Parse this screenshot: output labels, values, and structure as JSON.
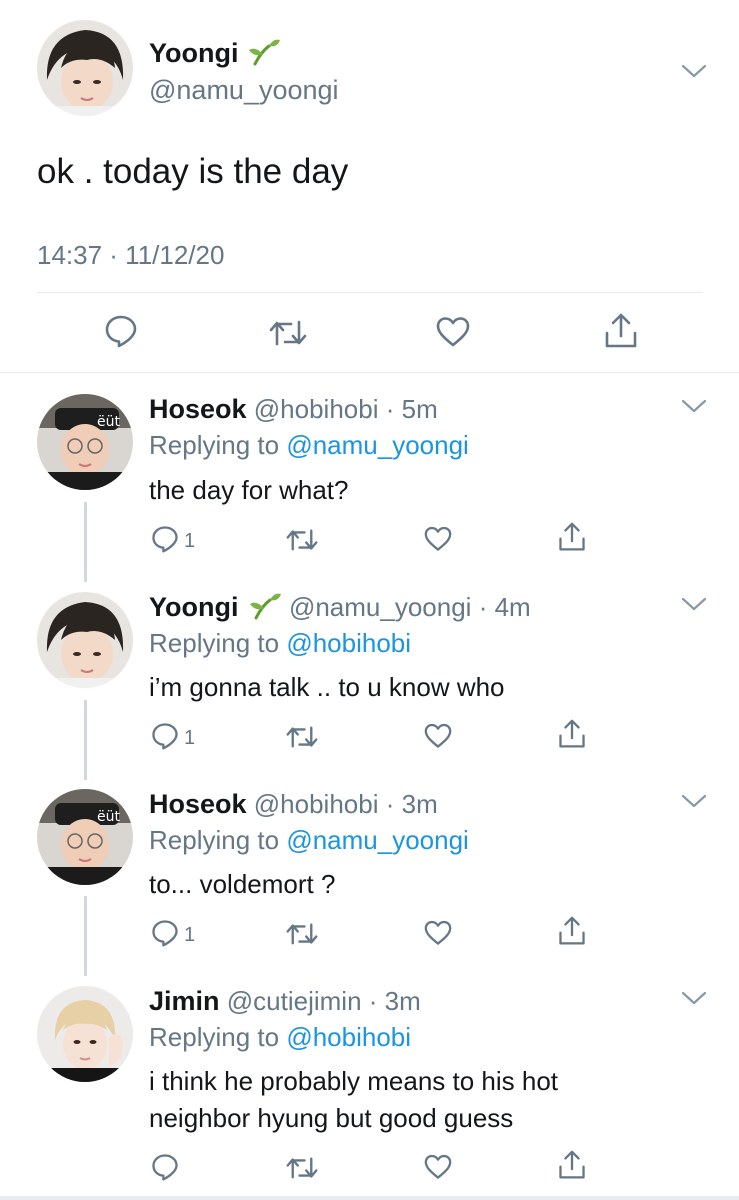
{
  "main_tweet": {
    "display_name": "Yoongi",
    "handle": "@namu_yoongi",
    "text": "ok . today is the day",
    "timestamp": "14:37 · 11/12/20"
  },
  "replies": [
    {
      "display_name": "Hoseok",
      "handle": "@hobihobi",
      "time": "· 5m",
      "replying_label": "Replying to",
      "replying_to": "@namu_yoongi",
      "text": "the day for what?",
      "reply_count": "1"
    },
    {
      "display_name": "Yoongi",
      "handle": "@namu_yoongi",
      "time": "· 4m",
      "replying_label": "Replying to",
      "replying_to": "@hobihobi",
      "text": "i’m gonna talk .. to u know who",
      "reply_count": "1"
    },
    {
      "display_name": "Hoseok",
      "handle": "@hobihobi",
      "time": "· 3m",
      "replying_label": "Replying to",
      "replying_to": "@namu_yoongi",
      "text": "to... voldemort ?",
      "reply_count": "1"
    },
    {
      "display_name": "Jimin",
      "handle": "@cutiejimin",
      "time": "· 3m",
      "replying_label": "Replying to",
      "replying_to": "@hobihobi",
      "text_line1": "i think he probably means to his hot",
      "text_line2": "neighbor hyung but good guess",
      "reply_count": ""
    }
  ],
  "icons": [
    "seedling-icon",
    "chevron-down-icon",
    "reply-icon",
    "retweet-icon",
    "like-icon",
    "share-icon"
  ],
  "colors": {
    "link": "#1b95e0",
    "secondary": "#657786",
    "divider": "#e6ecf0",
    "thread_line": "#cfd9de",
    "seedling": "#7cb342"
  }
}
